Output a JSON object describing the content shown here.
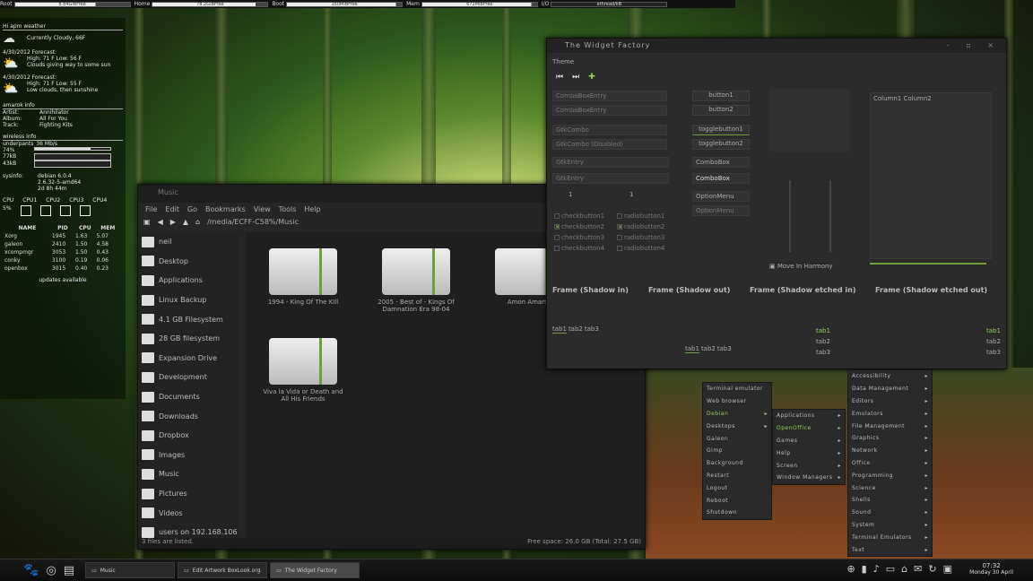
{
  "topbar": {
    "root_label": "Root",
    "root_val": "8.84GiBFree",
    "root_fill": 0.7,
    "home_label": "Home",
    "home_val": "78.2GiBFree",
    "home_fill": 0.9,
    "boot_label": "Boot",
    "boot_val": "150MiBFree",
    "boot_fill": 0.95,
    "mem_label": "Mem",
    "mem_val": "672MiBFree",
    "mem_fill": 0.95,
    "io_label": "I/O",
    "io_val": "ethread/kB"
  },
  "conky": {
    "weather_title": "Hi apm weather",
    "current": "Currently Cloudy, 66F",
    "f1_date": "4/30/2012 Forecast:",
    "f1_hl": "High: 71 F Low: 56 F",
    "f1_desc": "Clouds giving way to some sun",
    "f2_date": "4/30/2012 Forecast:",
    "f2_hl": "High: 71 F Low: 55 F",
    "f2_desc": "Low clouds, then sunshine",
    "music_title": "amarok info",
    "artist_label": "Artist:",
    "artist": "Annihilator",
    "album_label": "Album:",
    "album": "All For You",
    "track_label": "Track:",
    "track": "Fighting Kits",
    "wireless_title": "wireless info",
    "ssid": "underpants",
    "rate": "36 Mb/s",
    "link": "74%",
    "down": "77kB",
    "up": "43kB",
    "sys_label": "sysinfo:",
    "distro": "debian 6.0.4",
    "kernel": "2.6.32-5-amd64",
    "uptime": "2d 8h 44m",
    "cpu_labels": [
      "CPU",
      "CPU1",
      "CPU2",
      "CPU3",
      "CPU4"
    ],
    "cpu_val": "5%",
    "proc_headers": [
      "NAME",
      "PID",
      "CPU",
      "MEM"
    ],
    "procs": [
      [
        "Xorg",
        "1945",
        "1.63",
        "5.07"
      ],
      [
        "galeon",
        "2410",
        "1.50",
        "4.58"
      ],
      [
        "xcompmgr",
        "3053",
        "1.50",
        "0.43"
      ],
      [
        "conky",
        "3100",
        "0.19",
        "0.06"
      ],
      [
        "openbox",
        "3015",
        "0.40",
        "0.23"
      ]
    ],
    "updates": "updates available"
  },
  "fm": {
    "title": "Music",
    "menus": [
      "File",
      "Edit",
      "Go",
      "Bookmarks",
      "View",
      "Tools",
      "Help"
    ],
    "path": "/media/ECFF-C58%/Music",
    "side": [
      "neil",
      "Desktop",
      "Applications",
      "Linux Backup",
      "4.1 GB Filesystem",
      "28 GB filesystem",
      "Expansion Drive",
      "Development",
      "Documents",
      "Downloads",
      "Dropbox",
      "Images",
      "Music",
      "Pictures",
      "Videos",
      "users on 192.168.106"
    ],
    "folders": [
      "1994 - King Of The Kill",
      "2005 - Best of - Kings Of Damnation Era 98-04",
      "Amon Amarth",
      "Viva la Vida or Death and All His Friends"
    ],
    "status_left": "3 files are listed.",
    "status_right": "Free space: 26.0 GB (Total: 27.5 GB)"
  },
  "wf": {
    "title": "The Widget Factory",
    "theme": "Theme",
    "combo1": "ComboBoxEntry",
    "combo2": "ComboBoxEntry",
    "gtk1": "GtkCombo",
    "gtk2": "GtkCombo (Disabled)",
    "entry1": "GtkEntry",
    "entry2": "GtkEntry",
    "spin1": "1",
    "spin2": "1",
    "btn1": "button1",
    "btn2": "button2",
    "tog1": "togglebutton1",
    "tog2": "togglebutton2",
    "cb1": "ComboBox",
    "cb2": "ComboBox",
    "opt1": "OptionMenu",
    "opt2": "OptionMenu",
    "checks": [
      "checkbutton1",
      "checkbutton2",
      "checkbutton3",
      "checkbutton4"
    ],
    "radios": [
      "radiobutton1",
      "radiobutton2",
      "radiobutton3",
      "radiobutton4"
    ],
    "col1": "Column1",
    "col2": "Column2",
    "harmony": "Move In Harmony",
    "frames": [
      "Frame (Shadow in)",
      "Frame (Shadow out)",
      "Frame (Shadow etched in)",
      "Frame (Shadow etched out)"
    ],
    "tabs": [
      "tab1",
      "tab2",
      "tab3"
    ]
  },
  "menu1": [
    "Terminal emulator",
    "Web browser",
    "Debian",
    "Desktops",
    "Galeon",
    "Gimp",
    "Background",
    "Restart",
    "Logout",
    "Reboot",
    "Shutdown"
  ],
  "menu2": [
    "Applications",
    "OpenOffice",
    "Games",
    "Help",
    "Screen",
    "Window Managers"
  ],
  "menu3": [
    "Accessibility",
    "Data Management",
    "Editors",
    "Emulators",
    "File Management",
    "Graphics",
    "Network",
    "Office",
    "Programming",
    "Science",
    "Shells",
    "Sound",
    "System",
    "Terminal Emulators",
    "Text"
  ],
  "taskbar": {
    "tasks": [
      "Music",
      "Edit Artwork BoxLook.org",
      "The Widget Factory"
    ],
    "time": "07:32",
    "date": "Monday 30 April"
  }
}
